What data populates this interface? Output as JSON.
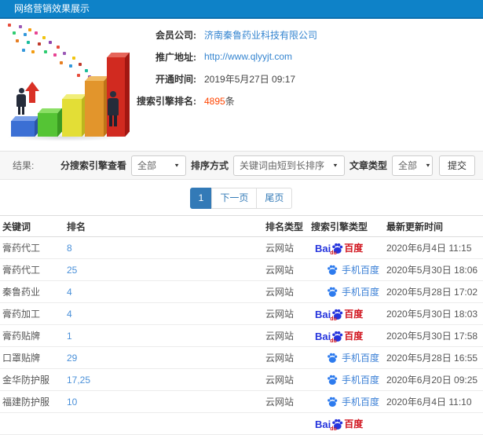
{
  "header": {
    "title": "网络营销效果展示"
  },
  "icons": {
    "chevron_down": "▼"
  },
  "colors": {
    "header_bg": "#0e82c8",
    "link_blue": "#3585d0",
    "count_red": "#ff4400",
    "pagination_active_bg": "#337ab7",
    "baidu_blue": "#2534dd",
    "baidu_red": "#d0111b"
  },
  "info": {
    "company_label": "会员公司:",
    "company_value": "济南秦鲁药业科技有限公司",
    "url_label": "推广地址:",
    "url_value": "http://www.qlyyjt.com",
    "open_time_label": "开通时间:",
    "open_time_value": "2019年5月27日 09:17",
    "rank_count_label": "搜索引擎排名:",
    "rank_count_value": "4895",
    "rank_count_unit": "条"
  },
  "filters": {
    "result_label": "结果:",
    "engine_view_label": "分搜索引擎查看",
    "engine_view_value": "全部",
    "sort_label": "排序方式",
    "sort_value": "关键词由短到长排序",
    "article_type_label": "文章类型",
    "article_type_value": "全部",
    "submit_label": "提交"
  },
  "pagination": {
    "current": "1",
    "next_label": "下一页",
    "last_label": "尾页"
  },
  "table": {
    "headers": [
      "关键词",
      "排名",
      "排名类型",
      "搜索引擎类型",
      "最新更新时间"
    ],
    "baidu_pc": {
      "bai": "Bai",
      "du": "du"
    },
    "rows": [
      {
        "keyword": "膏药代工",
        "rank": "8",
        "rank_type": "云网站",
        "engine": "baidu_pc",
        "engine_label": "百度",
        "date": "2020年6月4日 11:15"
      },
      {
        "keyword": "膏药代工",
        "rank": "25",
        "rank_type": "云网站",
        "engine": "baidu_mobile",
        "engine_label": "手机百度",
        "date": "2020年5月30日 18:06"
      },
      {
        "keyword": "秦鲁药业",
        "rank": "4",
        "rank_type": "云网站",
        "engine": "baidu_mobile",
        "engine_label": "手机百度",
        "date": "2020年5月28日 17:02"
      },
      {
        "keyword": "膏药加工",
        "rank": "4",
        "rank_type": "云网站",
        "engine": "baidu_pc",
        "engine_label": "百度",
        "date": "2020年5月30日 18:03"
      },
      {
        "keyword": "膏药贴牌",
        "rank": "1",
        "rank_type": "云网站",
        "engine": "baidu_pc",
        "engine_label": "百度",
        "date": "2020年5月30日 17:58"
      },
      {
        "keyword": "口罩贴牌",
        "rank": "29",
        "rank_type": "云网站",
        "engine": "baidu_mobile",
        "engine_label": "手机百度",
        "date": "2020年5月28日 16:55"
      },
      {
        "keyword": "金华防护服",
        "rank": "17,25",
        "rank_type": "云网站",
        "engine": "baidu_mobile",
        "engine_label": "手机百度",
        "date": "2020年6月20日 09:25"
      },
      {
        "keyword": "福建防护服",
        "rank": "10",
        "rank_type": "云网站",
        "engine": "baidu_mobile",
        "engine_label": "手机百度",
        "date": "2020年6月4日 11:10"
      },
      {
        "keyword": "",
        "rank": "",
        "rank_type": "",
        "engine": "baidu_pc",
        "engine_label": "百度",
        "date": ""
      }
    ]
  }
}
